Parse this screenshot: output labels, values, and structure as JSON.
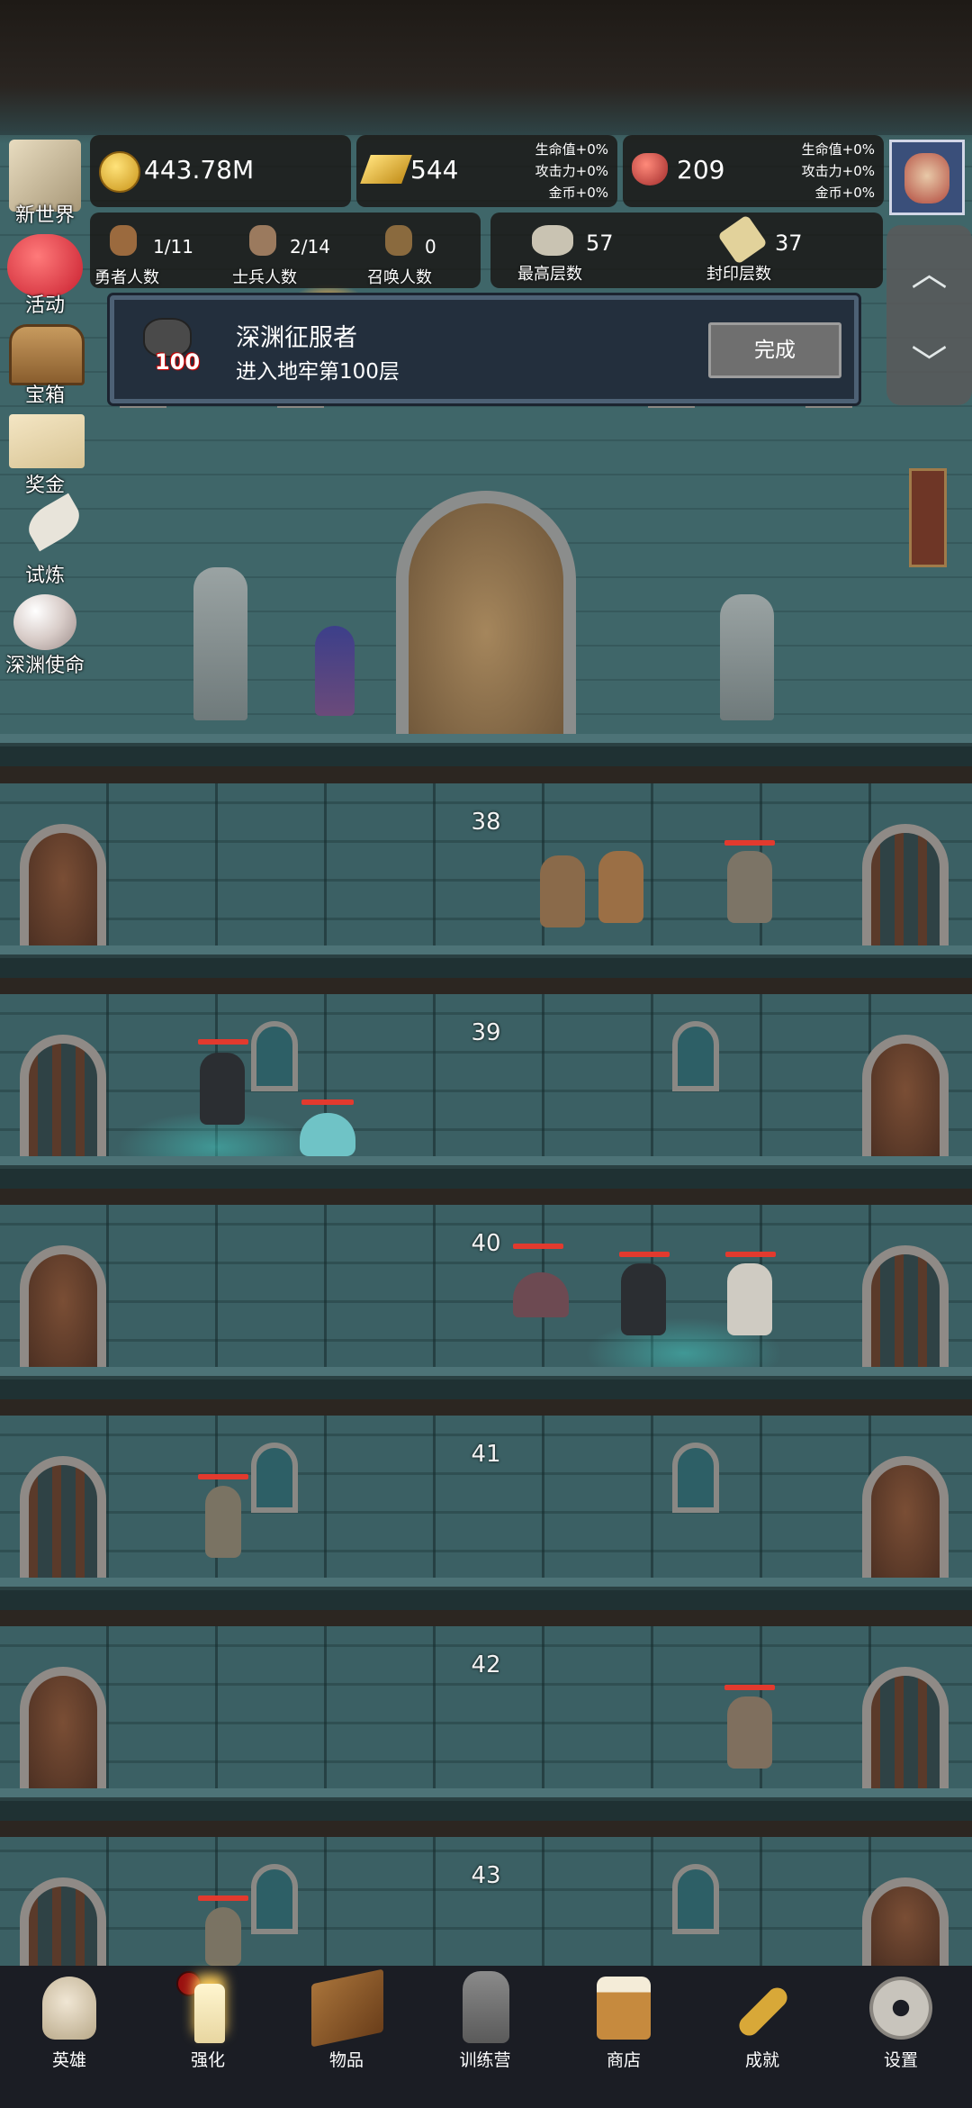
{
  "resources": {
    "gold": "443.78M",
    "gold_bar": "544",
    "gold_bar_bonus": [
      "生命值+0%",
      "攻击力+0%",
      "金币+0%"
    ],
    "gem": "209",
    "gem_bonus": [
      "生命值+0%",
      "攻击力+0%",
      "金币+0%"
    ]
  },
  "stats": {
    "heroes": {
      "value": "1/11",
      "label": "勇者人数"
    },
    "soldiers": {
      "value": "2/14",
      "label": "士兵人数"
    },
    "summons": {
      "value": "0",
      "label": "召唤人数"
    },
    "max_floor": {
      "value": "57",
      "label": "最高层数"
    },
    "sealed_floor": {
      "value": "37",
      "label": "封印层数"
    }
  },
  "side_menu": [
    {
      "label": "新世界",
      "icon": "map-icon"
    },
    {
      "label": "活动",
      "icon": "heart-icon"
    },
    {
      "label": "宝箱",
      "icon": "chest-icon"
    },
    {
      "label": "奖金",
      "icon": "envelope-icon"
    },
    {
      "label": "试炼",
      "icon": "feather-icon"
    },
    {
      "label": "深渊使命",
      "icon": "orb-icon"
    }
  ],
  "quest": {
    "badge": "100",
    "title": "深渊征服者",
    "description": "进入地牢第100层",
    "button": "完成"
  },
  "floors": [
    "38",
    "39",
    "40",
    "41",
    "42",
    "43"
  ],
  "nav": [
    {
      "label": "英雄",
      "icon": "skull-icon"
    },
    {
      "label": "强化",
      "icon": "candle-icon"
    },
    {
      "label": "物品",
      "icon": "book-icon"
    },
    {
      "label": "训练营",
      "icon": "lantern-icon"
    },
    {
      "label": "商店",
      "icon": "beer-icon"
    },
    {
      "label": "成就",
      "icon": "key-icon"
    },
    {
      "label": "设置",
      "icon": "gear-icon"
    }
  ],
  "colors": {
    "hp": "#e23a2e",
    "panel": "#1a1613",
    "quest_bg": "#232f3d"
  }
}
